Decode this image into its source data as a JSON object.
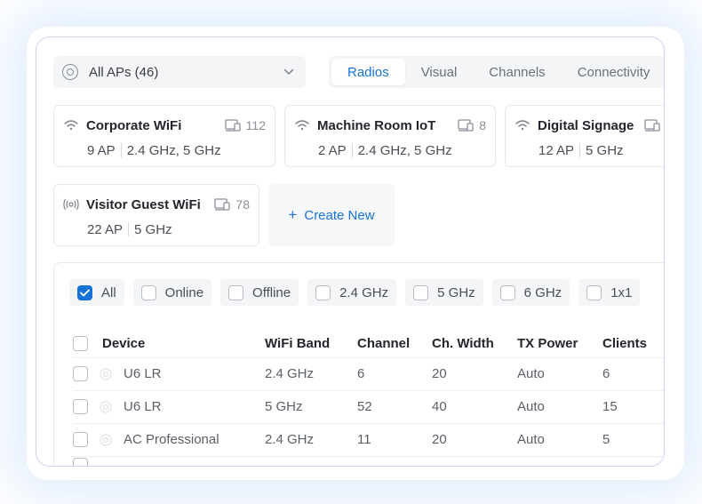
{
  "selector": {
    "label": "All APs (46)",
    "icon": "radar-icon"
  },
  "tabs": [
    {
      "label": "Radios",
      "active": true
    },
    {
      "label": "Visual",
      "active": false
    },
    {
      "label": "Channels",
      "active": false
    },
    {
      "label": "Connectivity",
      "active": false
    }
  ],
  "networks": [
    {
      "name": "Corporate WiFi",
      "count": "112",
      "aps": "9 AP",
      "bands": "2.4 GHz, 5 GHz",
      "icon": "wifi-icon"
    },
    {
      "name": "Machine Room IoT",
      "count": "8",
      "aps": "2 AP",
      "bands": "2.4 GHz, 5 GHz",
      "icon": "wifi-icon"
    },
    {
      "name": "Digital Signage",
      "count": "",
      "aps": "12 AP",
      "bands": "5 GHz",
      "icon": "wifi-icon"
    },
    {
      "name": "Visitor Guest WiFi",
      "count": "78",
      "aps": "22 AP",
      "bands": "5 GHz",
      "icon": "broadcast-icon"
    }
  ],
  "create_label": "Create New",
  "filters": [
    {
      "label": "All",
      "checked": true
    },
    {
      "label": "Online",
      "checked": false
    },
    {
      "label": "Offline",
      "checked": false
    },
    {
      "label": "2.4 GHz",
      "checked": false
    },
    {
      "label": "5 GHz",
      "checked": false
    },
    {
      "label": "6 GHz",
      "checked": false
    },
    {
      "label": "1x1",
      "checked": false
    }
  ],
  "table": {
    "headers": {
      "device": "Device",
      "band": "WiFi Band",
      "channel": "Channel",
      "width": "Ch. Width",
      "tx": "TX Power",
      "clients": "Clients"
    },
    "rows": [
      {
        "device": "U6 LR",
        "band": "2.4 GHz",
        "channel": "6",
        "width": "20",
        "tx": "Auto",
        "clients": "6"
      },
      {
        "device": "U6 LR",
        "band": "5 GHz",
        "channel": "52",
        "width": "40",
        "tx": "Auto",
        "clients": "15"
      },
      {
        "device": "AC Professional",
        "band": "2.4 GHz",
        "channel": "11",
        "width": "20",
        "tx": "Auto",
        "clients": "5"
      }
    ]
  },
  "colors": {
    "accent": "#1773d6",
    "border": "#e6e8ec",
    "frame": "#d9cdf0"
  }
}
